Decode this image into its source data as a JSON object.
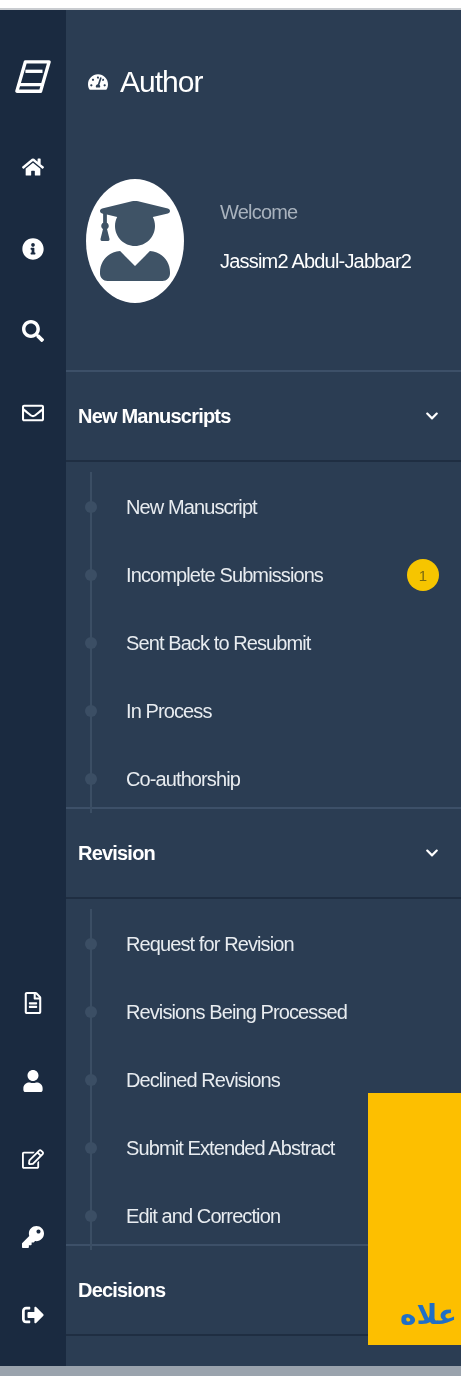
{
  "header": {
    "title": "Author"
  },
  "profile": {
    "greeting": "Welcome",
    "name": "Jassim2 Abdul-Jabbar2"
  },
  "sections": [
    {
      "title": "New Manuscripts",
      "expanded": true,
      "items": [
        {
          "label": "New Manuscript"
        },
        {
          "label": "Incomplete Submissions",
          "badge": "1"
        },
        {
          "label": "Sent Back to Resubmit"
        },
        {
          "label": "In Process"
        },
        {
          "label": "Co-authorship"
        }
      ]
    },
    {
      "title": "Revision",
      "expanded": true,
      "items": [
        {
          "label": "Request for Revision"
        },
        {
          "label": "Revisions Being Processed"
        },
        {
          "label": "Declined Revisions"
        },
        {
          "label": "Submit Extended Abstract"
        },
        {
          "label": "Edit and Correction"
        }
      ]
    },
    {
      "title": "Decisions",
      "expanded": false
    }
  ],
  "callout": {
    "text": "علاه"
  }
}
